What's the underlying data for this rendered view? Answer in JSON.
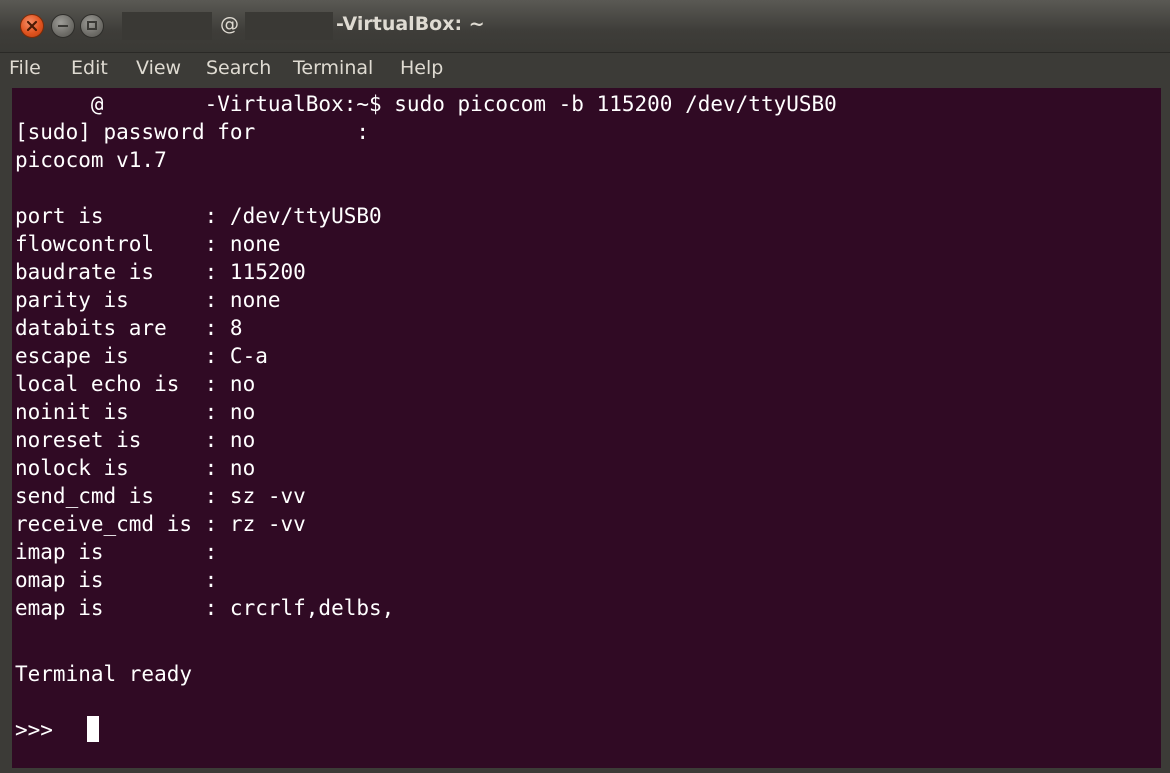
{
  "window": {
    "title_at": "@",
    "title": "-VirtualBox: ~"
  },
  "menu": {
    "items": [
      "File",
      "Edit",
      "View",
      "Search",
      "Terminal",
      "Help"
    ]
  },
  "terminal": {
    "lines": [
      "      @        -VirtualBox:~$ sudo picocom -b 115200 /dev/ttyUSB0",
      "[sudo] password for        :",
      "picocom v1.7",
      "",
      "port is        : /dev/ttyUSB0",
      "flowcontrol    : none",
      "baudrate is    : 115200",
      "parity is      : none",
      "databits are   : 8",
      "escape is      : C-a",
      "local echo is  : no",
      "noinit is      : no",
      "noreset is     : no",
      "nolock is      : no",
      "send_cmd is    : sz -vv",
      "receive_cmd is : rz -vv",
      "imap is        :",
      "omap is        :",
      "emap is        : crcrlf,delbs,",
      "",
      "Terminal ready",
      "",
      ">>> "
    ]
  },
  "colors": {
    "terminal_bg": "#300a24",
    "terminal_fg": "#ffffff",
    "chrome_bg": "#3c3b37",
    "close_button": "#e0531f"
  },
  "icons": {
    "close": "close-icon",
    "minimize": "minimize-icon",
    "maximize": "maximize-icon"
  }
}
